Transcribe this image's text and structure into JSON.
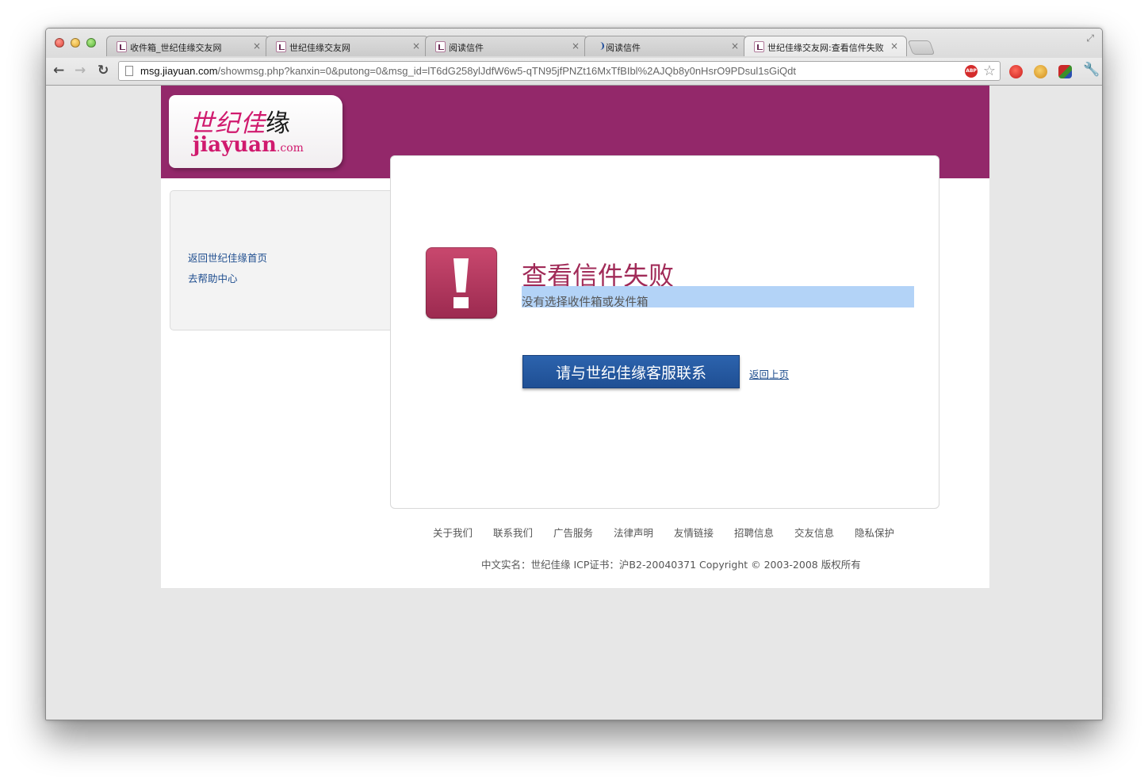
{
  "browser": {
    "tabs": [
      {
        "title": "收件箱_世纪佳缘交友网",
        "icon": "jiayuan-favicon"
      },
      {
        "title": "世纪佳缘交友网",
        "icon": "jiayuan-favicon"
      },
      {
        "title": "阅读信件",
        "icon": "jiayuan-favicon"
      },
      {
        "title": "阅读信件",
        "icon": "loading-moon-icon"
      },
      {
        "title": "世纪佳缘交友网:查看信件失败",
        "icon": "jiayuan-favicon",
        "active": true
      }
    ],
    "url_host": "msg.jiayuan.com",
    "url_path": "/showmsg.php?kanxin=0&putong=0&msg_id=lT6dG258ylJdfW6w5-qTN95jfPNZt16MxTfBIbl%2AJQb8y0nHsrO9PDsul1sGiQdt",
    "tab_close_glyph": "×",
    "extension_labels": {
      "abp": "ABP"
    }
  },
  "logo": {
    "cn_text": "世纪佳",
    "cn_last": "缘",
    "en_text": "jiayuan",
    "en_suffix": ".com"
  },
  "sidebar": {
    "links": [
      "返回世纪佳缘首页",
      "去帮助中心"
    ]
  },
  "error": {
    "title": "查看信件失败",
    "message": "没有选择收件箱或发件箱",
    "contact_button": "请与世纪佳缘客服联系",
    "back_link": "返回上页"
  },
  "footer": {
    "links": [
      "关于我们",
      "联系我们",
      "广告服务",
      "法律声明",
      "友情链接",
      "招聘信息",
      "交友信息",
      "隐私保护"
    ],
    "copyright": "中文实名：世纪佳缘 ICP证书：沪B2-20040371 Copyright © 2003-2008 版权所有"
  },
  "colors": {
    "brand_magenta": "#93286a",
    "error_title": "#a12b58",
    "button_blue": "#1f4f94",
    "selection_highlight": "#b3d3f7"
  }
}
